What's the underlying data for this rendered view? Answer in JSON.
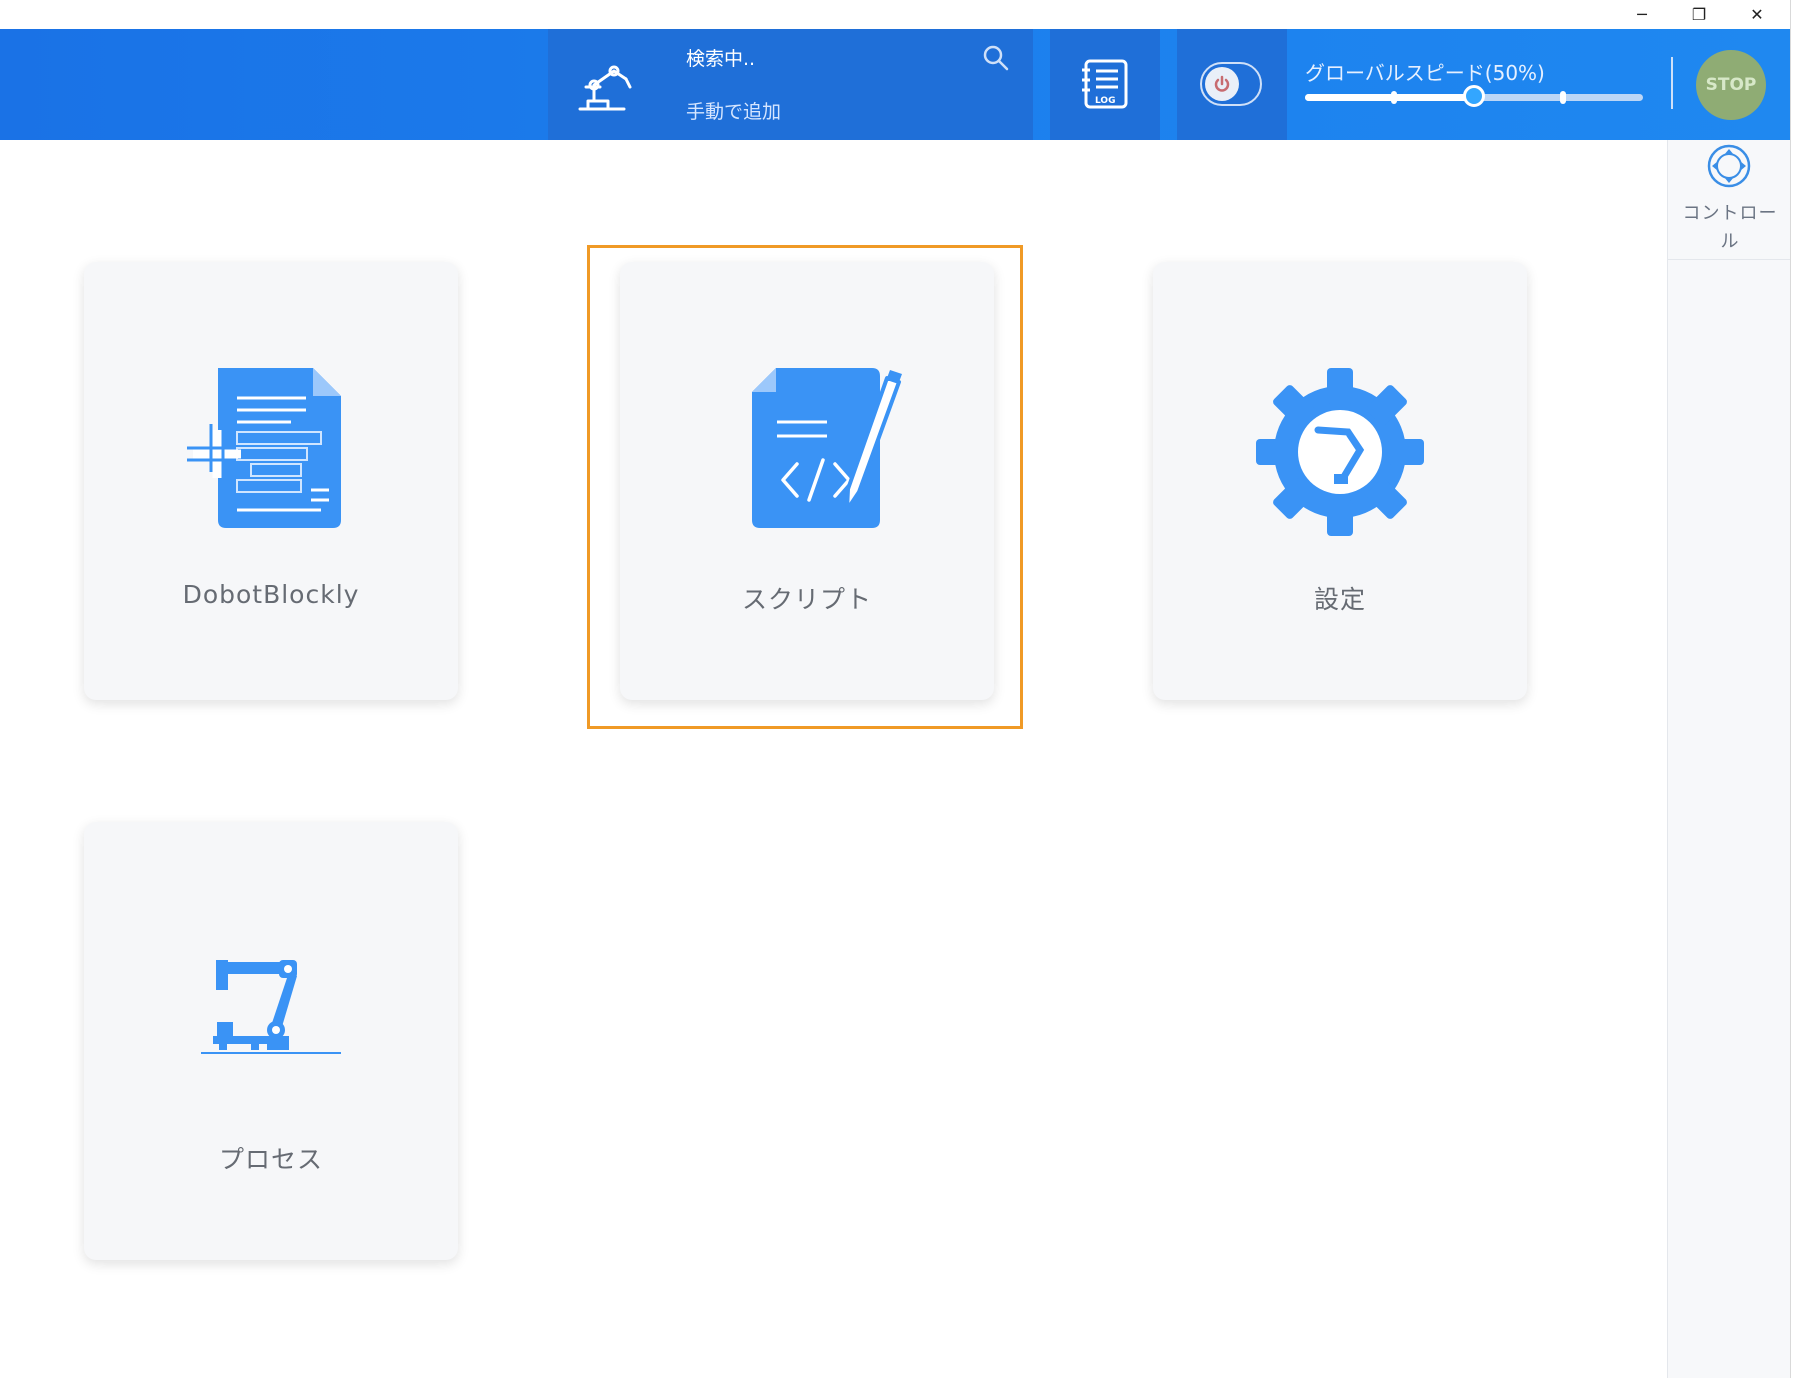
{
  "window": {
    "controls": {
      "minimize": "─",
      "restore": "❐",
      "close": "✕"
    }
  },
  "header": {
    "search_status": "検索中..",
    "manual_add": "手動で追加",
    "speed_label": "グローバルスピード(50%)",
    "speed_percent": 50,
    "stop_label": "STOP"
  },
  "sidebar": {
    "control_label": "コントロール"
  },
  "cards": {
    "blockly": {
      "label": "DobotBlockly"
    },
    "script": {
      "label": "スクリプト"
    },
    "settings": {
      "label": "設定"
    },
    "process": {
      "label": "プロセス"
    }
  },
  "colors": {
    "header_blue": "#1a72e6",
    "icon_blue": "#3a93f5",
    "highlight_orange": "#f09a26",
    "stop_green": "#8fac74"
  },
  "icons": [
    "robot-arm-icon",
    "search-icon",
    "log-icon",
    "power-icon",
    "direction-control-icon",
    "blockly-doc-icon",
    "script-doc-icon",
    "settings-gear-icon",
    "process-robot-icon"
  ]
}
